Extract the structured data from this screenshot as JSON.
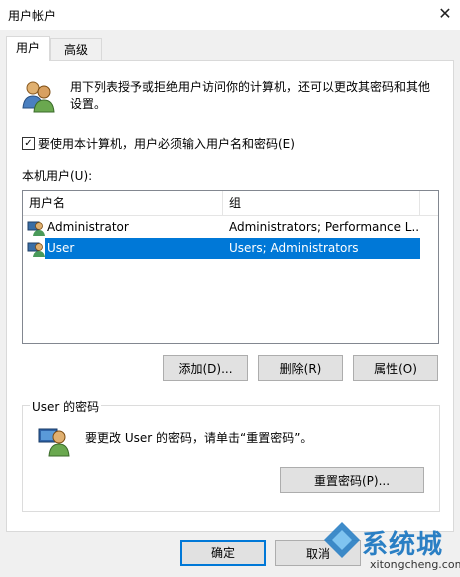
{
  "window": {
    "title": "用户帐户",
    "close_glyph": "✕"
  },
  "tabs": [
    {
      "label": "用户",
      "active": true
    },
    {
      "label": "高级",
      "active": false
    }
  ],
  "description": "用下列表授予或拒绝用户访问你的计算机，还可以更改其密码和其他设置。",
  "require_login": {
    "label": "要使用本计算机，用户必须输入用户名和密码(E)",
    "checked": true,
    "glyph": "✓"
  },
  "users_list": {
    "label": "本机用户(U):",
    "columns": [
      "用户名",
      "组"
    ],
    "rows": [
      {
        "name": "Administrator",
        "group": "Administrators; Performance L...",
        "selected": false
      },
      {
        "name": "User",
        "group": "Users; Administrators",
        "selected": true
      }
    ]
  },
  "list_buttons": {
    "add": "添加(D)...",
    "remove": "删除(R)",
    "properties": "属性(O)"
  },
  "password_group": {
    "title": "User 的密码",
    "text": "要更改 User 的密码，请单击“重置密码”。",
    "reset_button": "重置密码(P)..."
  },
  "footer": {
    "ok": "确定",
    "cancel": "取消"
  },
  "watermark": {
    "brand": "系统城",
    "url": "xitongcheng.com"
  },
  "colors": {
    "selection": "#0078d7",
    "default_button_border": "#0078d7",
    "watermark": "#2a7fc4"
  },
  "icons": [
    "users-icon",
    "user-row-icon",
    "user-password-icon",
    "watermark-logo-icon"
  ]
}
